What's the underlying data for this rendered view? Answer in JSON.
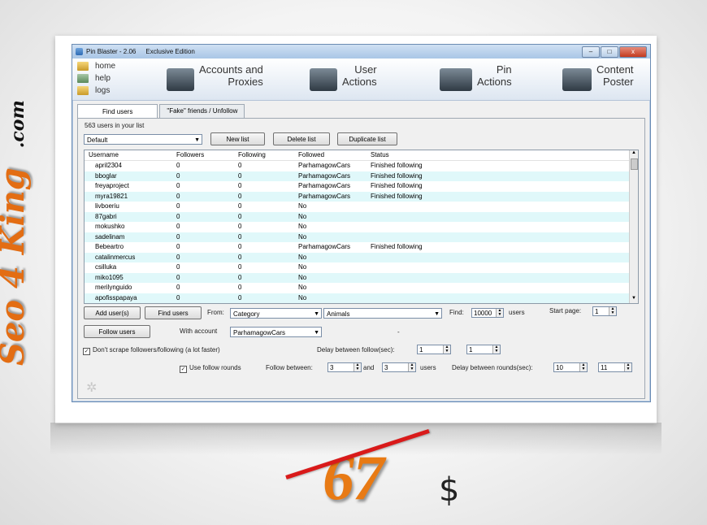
{
  "branding": {
    "side_text": "Seo 4 King",
    "side_suffix": ".com",
    "price": "67",
    "currency": "$",
    "accent_color": "#e87a14",
    "strike_color": "#d91a1a"
  },
  "window": {
    "title": "Pin Blaster - 2.06",
    "edition": "Exclusive Edition",
    "min": "–",
    "max": "□",
    "close": "x"
  },
  "quick_links": [
    "home",
    "help",
    "logs"
  ],
  "toolbar": {
    "accounts_line1": "Accounts and",
    "accounts_line2": "Proxies",
    "user_line1": "User",
    "user_line2": "Actions",
    "pin_line1": "Pin",
    "pin_line2": "Actions",
    "content_line1": "Content",
    "content_line2": "Poster"
  },
  "tabs": [
    "Find users",
    "\"Fake\" friends / Unfollow"
  ],
  "list": {
    "count_label": "563 users in your list",
    "selected": "Default",
    "new_btn": "New list",
    "delete_btn": "Delete list",
    "duplicate_btn": "Duplicate list"
  },
  "table": {
    "headers": [
      "Username",
      "Followers",
      "Following",
      "Followed",
      "Status"
    ],
    "rows": [
      [
        "april2304",
        "0",
        "0",
        "ParhamagowCars",
        "Finished following"
      ],
      [
        "bboglar",
        "0",
        "0",
        "ParhamagowCars",
        "Finished following"
      ],
      [
        "freyaproject",
        "0",
        "0",
        "ParhamagowCars",
        "Finished following"
      ],
      [
        "myra19821",
        "0",
        "0",
        "ParhamagowCars",
        "Finished following"
      ],
      [
        "livboeriu",
        "0",
        "0",
        "No",
        ""
      ],
      [
        "87gabri",
        "0",
        "0",
        "No",
        ""
      ],
      [
        "mokushko",
        "0",
        "0",
        "No",
        ""
      ],
      [
        "sadelinam",
        "0",
        "0",
        "No",
        ""
      ],
      [
        "Bebeartro",
        "0",
        "0",
        "ParhamagowCars",
        "Finished following"
      ],
      [
        "catalinmercus",
        "0",
        "0",
        "No",
        ""
      ],
      [
        "csilluka",
        "0",
        "0",
        "No",
        ""
      ],
      [
        "miko1095",
        "0",
        "0",
        "No",
        ""
      ],
      [
        "merilynguido",
        "0",
        "0",
        "No",
        ""
      ],
      [
        "apofisspapaya",
        "0",
        "0",
        "No",
        ""
      ]
    ]
  },
  "controls": {
    "add_users": "Add user(s)",
    "find_users": "Find users",
    "from_label": "From:",
    "from_value": "Category",
    "category_value": "Animals",
    "find_label": "Find:",
    "find_value": "10000",
    "users_label": "users",
    "start_page_label": "Start page:",
    "start_page_value": "1",
    "follow_users": "Follow users",
    "with_account_label": "With account",
    "account_value": "ParhamagowCars",
    "dash": "-",
    "dont_scrape": "Don't scrape followers/following (a lot faster)",
    "delay_follow_label": "Delay between follow(sec):",
    "delay_follow_min": "1",
    "delay_follow_max": "1",
    "use_rounds": "Use follow rounds",
    "follow_between_label": "Follow between:",
    "between_min": "3",
    "and_label": "and",
    "between_max": "3",
    "users_label2": "users",
    "delay_rounds_label": "Delay between rounds(sec):",
    "delay_rounds_min": "10",
    "delay_rounds_max": "11",
    "check_mark": "✓"
  }
}
